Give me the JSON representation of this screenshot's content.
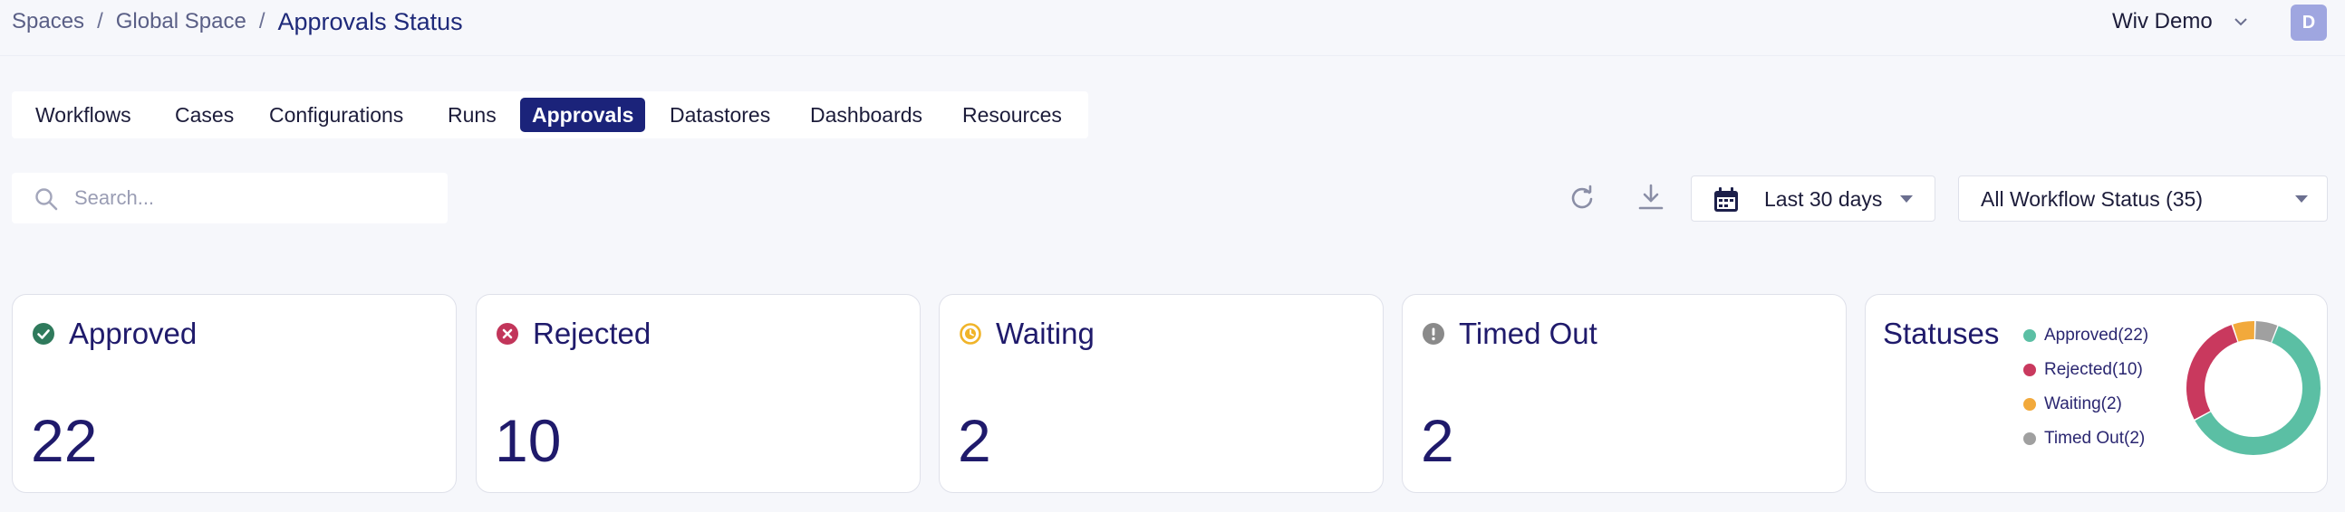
{
  "breadcrumb": {
    "items": [
      "Spaces",
      "Global Space"
    ],
    "separator": "/",
    "current": "Approvals Status"
  },
  "account": {
    "name": "Wiv Demo",
    "avatar_letter": "D",
    "avatar_color": "#9fa6e0"
  },
  "tabs": [
    "Workflows",
    "Cases",
    "Configurations",
    "Runs",
    "Approvals",
    "Datastores",
    "Dashboards",
    "Resources"
  ],
  "active_tab": "Approvals",
  "toolbar": {
    "search_placeholder": "Search...",
    "date_range": "Last 30 days",
    "status_filter": "All Workflow Status (35)",
    "icons": [
      "refresh-icon",
      "download-icon",
      "calendar-icon",
      "caret-down-icon"
    ]
  },
  "cards": [
    {
      "label": "Approved",
      "value": "22",
      "icon": "check-circle-icon",
      "color": "#2f8a62"
    },
    {
      "label": "Rejected",
      "value": "10",
      "icon": "x-circle-icon",
      "color": "#c2355a"
    },
    {
      "label": "Waiting",
      "value": "2",
      "icon": "clock-circle-icon",
      "color": "#f0b429"
    },
    {
      "label": "Timed Out",
      "value": "2",
      "icon": "exclamation-circle-icon",
      "color": "#8a8a8a"
    }
  ],
  "statuses": {
    "title": "Statuses",
    "legend": [
      {
        "label": "Approved(22)",
        "count": 22,
        "color": "#5bbfa4"
      },
      {
        "label": "Rejected(10)",
        "count": 10,
        "color": "#c9395e"
      },
      {
        "label": "Waiting(2)",
        "count": 2,
        "color": "#f2a93b"
      },
      {
        "label": "Timed Out(2)",
        "count": 2,
        "color": "#a0a0a0"
      }
    ]
  },
  "colors": {
    "accent": "#1b237a",
    "text": "#1f1a6b",
    "background": "#f6f7fb"
  }
}
